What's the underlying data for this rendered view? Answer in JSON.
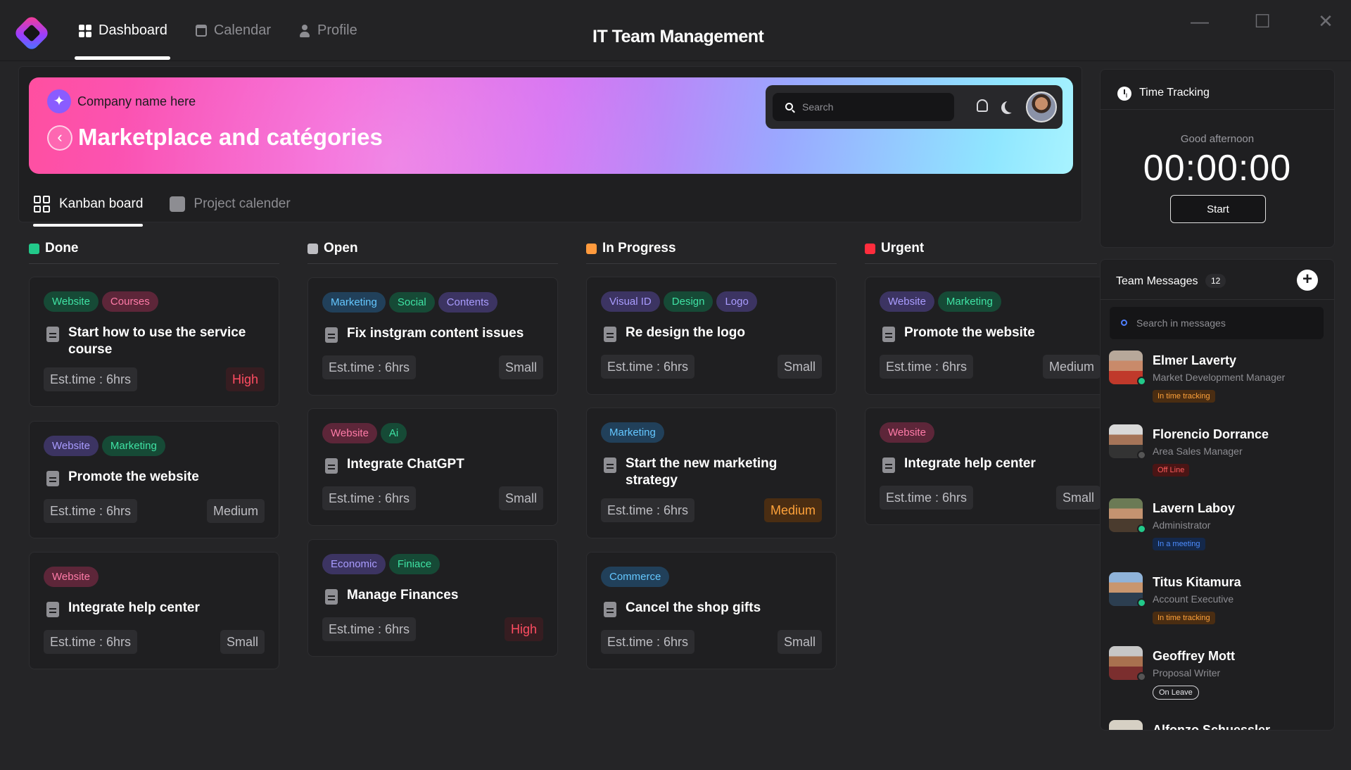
{
  "nav": {
    "tabs": [
      {
        "label": "Dashboard",
        "icon": "dashboard-icon",
        "active": true
      },
      {
        "label": "Calendar",
        "icon": "calendar-icon",
        "active": false
      },
      {
        "label": "Profile",
        "icon": "profile-icon",
        "active": false
      }
    ],
    "app_title": "IT Team Management"
  },
  "window_controls": {
    "minimize": "—",
    "maximize": "☐",
    "close": "✕"
  },
  "hero": {
    "company": "Company name here",
    "title": "Marketplace and catégories",
    "search_placeholder": "Search"
  },
  "sub_tabs": [
    {
      "label": "Kanban board",
      "active": true
    },
    {
      "label": "Project calender",
      "active": false
    }
  ],
  "colors": {
    "done": "#22c98a",
    "open": "#bdbdc2",
    "in_progress": "#ff9a3d",
    "urgent": "#ff2d3d",
    "accent": "#8a5cff"
  },
  "columns": [
    {
      "title": "Done",
      "cards": [
        {
          "tags": [
            "Website",
            "Courses"
          ],
          "title": "Start how to use the service course",
          "est": "Est.time : 6hrs",
          "priority": "High"
        },
        {
          "tags": [
            "Website",
            "Marketing"
          ],
          "title": "Promote the website",
          "est": "Est.time : 6hrs",
          "priority": "Medium"
        },
        {
          "tags": [
            "Website"
          ],
          "title": "Integrate help center",
          "est": "Est.time : 6hrs",
          "priority": "Small"
        }
      ]
    },
    {
      "title": "Open",
      "cards": [
        {
          "tags": [
            "Marketing",
            "Social",
            "Contents"
          ],
          "title": "Fix instgram content issues",
          "est": "Est.time : 6hrs",
          "priority": "Small"
        },
        {
          "tags": [
            "Website",
            "Ai"
          ],
          "title": "Integrate ChatGPT",
          "est": "Est.time : 6hrs",
          "priority": "Small"
        },
        {
          "tags": [
            "Economic",
            "Finiace"
          ],
          "title": "Manage Finances",
          "est": "Est.time : 6hrs",
          "priority": "High"
        }
      ]
    },
    {
      "title": "In Progress",
      "cards": [
        {
          "tags": [
            "Visual ID",
            "Design",
            "Logo"
          ],
          "title": "Re design the logo",
          "est": "Est.time : 6hrs",
          "priority": "Small"
        },
        {
          "tags": [
            "Marketing"
          ],
          "title": "Start the new marketing strategy",
          "est": "Est.time : 6hrs",
          "priority": "Medium"
        },
        {
          "tags": [
            "Commerce"
          ],
          "title": "Cancel the shop gifts",
          "est": "Est.time : 6hrs",
          "priority": "Small"
        }
      ]
    },
    {
      "title": "Urgent",
      "cards": [
        {
          "tags": [
            "Website",
            "Marketing"
          ],
          "title": "Promote the website",
          "est": "Est.time : 6hrs",
          "priority": "Medium"
        },
        {
          "tags": [
            "Website"
          ],
          "title": "Integrate help center",
          "est": "Est.time : 6hrs",
          "priority": "Small"
        }
      ]
    }
  ],
  "time_tracking": {
    "title": "Time Tracking",
    "greeting": "Good afternoon",
    "timer": "00:00:00",
    "start_label": "Start"
  },
  "team_messages": {
    "title": "Team Messages",
    "count": "12",
    "search_placeholder": "Search in messages",
    "people": [
      {
        "name": "Elmer Laverty",
        "role": "Market Development Manager",
        "badge": "In time tracking"
      },
      {
        "name": "Florencio Dorrance",
        "role": "Area Sales Manager",
        "badge": "Off Line"
      },
      {
        "name": "Lavern Laboy",
        "role": "Administrator",
        "badge": "In a meeting"
      },
      {
        "name": "Titus Kitamura",
        "role": "Account Executive",
        "badge": "In time tracking"
      },
      {
        "name": "Geoffrey Mott",
        "role": "Proposal Writer",
        "badge": "On Leave"
      },
      {
        "name": "Alfonzo Schuessler",
        "role": "",
        "badge": ""
      }
    ]
  }
}
